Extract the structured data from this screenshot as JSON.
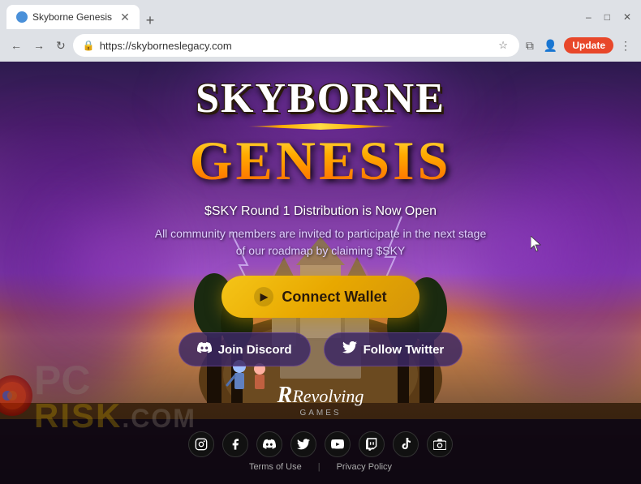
{
  "browser": {
    "tab_title": "Skyborne Genesis",
    "url": "https://skyborneslegacy.com",
    "new_tab_label": "+",
    "back_btn": "←",
    "forward_btn": "→",
    "refresh_btn": "↻",
    "update_btn": "Update",
    "minimize_btn": "–",
    "maximize_btn": "□",
    "close_btn": "✕"
  },
  "hero": {
    "logo_line1": "SKYBORNE",
    "logo_line2": "GENESIS",
    "subtitle_main": "$SKY Round 1 Distribution is Now Open",
    "subtitle_sub_line1": "All community members are invited to participate in the next stage",
    "subtitle_sub_line2": "of our roadmap by claiming $SKY"
  },
  "buttons": {
    "connect_wallet": "Connect Wallet",
    "join_discord": "Join Discord",
    "follow_twitter": "Follow Twitter"
  },
  "revolving": {
    "label": "Revolving",
    "sublabel": "GAMES"
  },
  "footer": {
    "social_icons": [
      "instagram",
      "facebook",
      "discord",
      "twitter",
      "youtube",
      "twitch",
      "tiktok",
      "camera"
    ],
    "terms_of_use": "Terms of Use",
    "privacy_policy": "Privacy Policy"
  },
  "watermark": {
    "text": "RISK.COM",
    "pc_text": "PC"
  }
}
